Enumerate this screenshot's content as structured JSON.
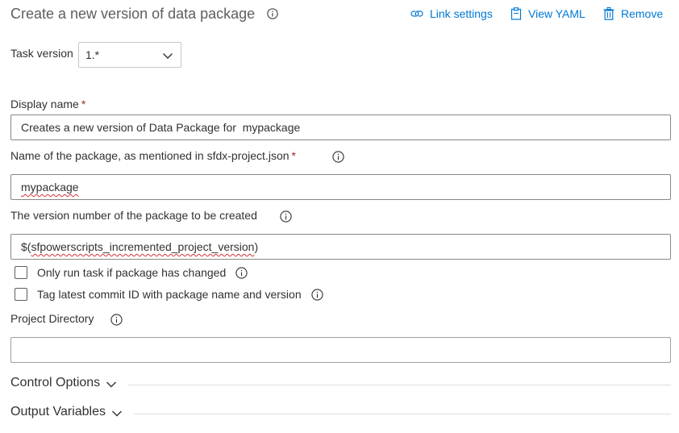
{
  "header": {
    "title": "Create a new version of data package",
    "actions": [
      {
        "label": "Link settings",
        "icon": "link-icon"
      },
      {
        "label": "View YAML",
        "icon": "clipboard-icon"
      },
      {
        "label": "Remove",
        "icon": "trash-icon"
      }
    ]
  },
  "task_version": {
    "label": "Task version",
    "selected": "1.*"
  },
  "fields": {
    "display_name": {
      "label": "Display name",
      "required": "*",
      "value": "Creates a new version of Data Package for  mypackage"
    },
    "package_name": {
      "label": "Name of the package, as mentioned in sfdx-project.json",
      "required": "*",
      "value": "mypackage"
    },
    "version_number": {
      "label": "The version number of the package to be created",
      "value_prefix": "$(",
      "value_misspelled": "sfpowerscripts_incremented_project_version",
      "value_suffix": ")"
    },
    "project_directory": {
      "label": "Project Directory",
      "value": ""
    }
  },
  "checkboxes": [
    {
      "label": "Only run task if package has changed",
      "checked": false
    },
    {
      "label": "Tag latest commit ID with package name and version",
      "checked": false
    }
  ],
  "sections": {
    "control_options": "Control Options",
    "output_variables": "Output Variables"
  },
  "colors": {
    "accent": "#0078d4",
    "required": "#a4262c",
    "spellcheck": "#d13438",
    "title": "#605e5c"
  }
}
